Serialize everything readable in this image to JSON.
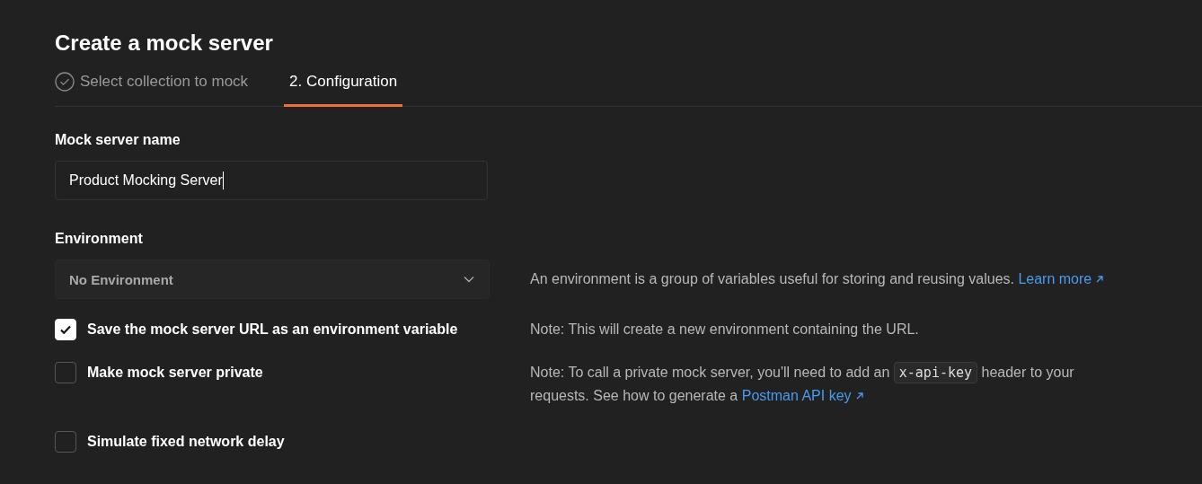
{
  "title": "Create a mock server",
  "steps": [
    {
      "label": "Select collection to mock",
      "selected": false,
      "completed": true
    },
    {
      "label": "2. Configuration",
      "selected": true,
      "completed": false
    }
  ],
  "name_field": {
    "label": "Mock server name",
    "value": "Product Mocking Server"
  },
  "environment": {
    "label": "Environment",
    "value": "No Environment",
    "help": [
      {
        "kind": "text",
        "text": "An environment is a group of variables useful for storing and reusing values. "
      },
      {
        "kind": "link",
        "text": "Learn more"
      }
    ]
  },
  "options": [
    {
      "label": "Save the mock server URL as an environment variable",
      "checked": true,
      "note": [
        {
          "kind": "text",
          "text": "Note: This will create a new environment containing the URL."
        }
      ]
    },
    {
      "label": "Make mock server private",
      "checked": false,
      "note": [
        {
          "kind": "text",
          "text": "Note: To call a private mock server, you'll need to add an "
        },
        {
          "kind": "code",
          "text": "x-api-key"
        },
        {
          "kind": "text",
          "text": " header to your requests. See how to generate a "
        },
        {
          "kind": "link",
          "text": "Postman API key"
        }
      ]
    },
    {
      "label": "Simulate fixed network delay",
      "checked": false
    }
  ]
}
